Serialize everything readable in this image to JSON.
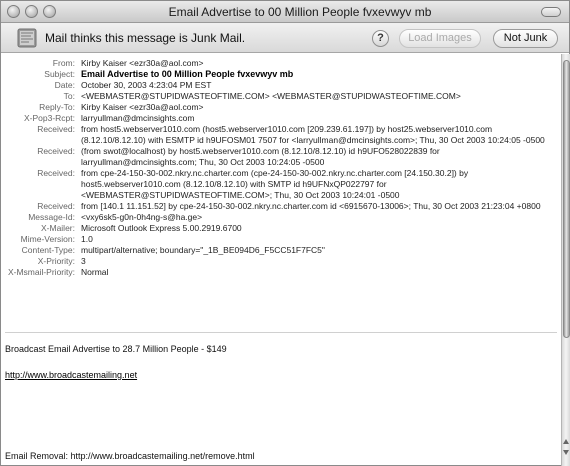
{
  "window": {
    "title": "Email Advertise to 00 Million People fvxevwyv mb"
  },
  "junkbar": {
    "message": "Mail thinks this message is Junk Mail.",
    "help": "?",
    "load_images": "Load Images",
    "not_junk": "Not Junk"
  },
  "headers": [
    {
      "label": "From:",
      "value": "Kirby Kaiser <ezr30a@aol.com>"
    },
    {
      "label": "Subject:",
      "value": "Email Advertise to 00 Million People fvxevwyv mb",
      "bold": true
    },
    {
      "label": "Date:",
      "value": "October 30, 2003 4:23:04 PM EST"
    },
    {
      "label": "To:",
      "value": "<WEBMASTER@STUPIDWASTEOFTIME.COM> <WEBMASTER@STUPIDWASTEOFTIME.COM>"
    },
    {
      "label": "Reply-To:",
      "value": "Kirby Kaiser <ezr30a@aol.com>"
    },
    {
      "label": "X-Pop3-Rcpt:",
      "value": "larryullman@dmcinsights.com"
    },
    {
      "label": "Received:",
      "value": "from host5.webserver1010.com (host5.webserver1010.com [209.239.61.197]) by host25.webserver1010.com (8.12.10/8.12.10) with ESMTP id h9UFOSM01 7507 for <larryullman@dmcinsights.com>; Thu, 30 Oct 2003 10:24:05 -0500"
    },
    {
      "label": "Received:",
      "value": "(from swot@localhost) by host5.webserver1010.com (8.12.10/8.12.10) id h9UFO528022839 for larryullman@dmcinsights.com; Thu, 30 Oct 2003 10:24:05 -0500"
    },
    {
      "label": "Received:",
      "value": "from cpe-24-150-30-002.nkry.nc.charter.com (cpe-24-150-30-002.nkry.nc.charter.com [24.150.30.2]) by host5.webserver1010.com (8.12.10/8.12.10) with SMTP id h9UFNxQP022797 for <WEBMASTER@STUPIDWASTEOFTIME.COM>; Thu, 30 Oct 2003 10:24:01 -0500"
    },
    {
      "label": "Received:",
      "value": "from [140.1 11.151.52] by cpe-24-150-30-002.nkry.nc.charter.com id <6915670-13006>; Thu, 30 Oct 2003 21:23:04 +0800"
    },
    {
      "label": "Message-Id:",
      "value": "<vxy6sk5-g0n-0h4ng-s@ha.ge>"
    },
    {
      "label": "X-Mailer:",
      "value": "Microsoft Outlook Express 5.00.2919.6700"
    },
    {
      "label": "Mime-Version:",
      "value": "1.0"
    },
    {
      "label": "Content-Type:",
      "value": "multipart/alternative; boundary=\"_1B_BE094D6_F5CC51F7FC5\""
    },
    {
      "label": "X-Priority:",
      "value": "3"
    },
    {
      "label": "X-Msmail-Priority:",
      "value": "Normal"
    }
  ],
  "body": {
    "line1": "Broadcast Email Advertise to 28.7 Million People - $149",
    "link": "http://www.broadcastemailing.net",
    "removal": "Email Removal: http://www.broadcastemailing.net/remove.html"
  },
  "colors": {
    "titlebar": "#cfcfcf",
    "junkbar": "#e3e3e3",
    "label_gray": "#666666"
  },
  "icons": [
    "close-icon",
    "minimize-icon",
    "zoom-icon",
    "toolbar-toggle-icon",
    "junk-mail-icon",
    "help-icon"
  ]
}
